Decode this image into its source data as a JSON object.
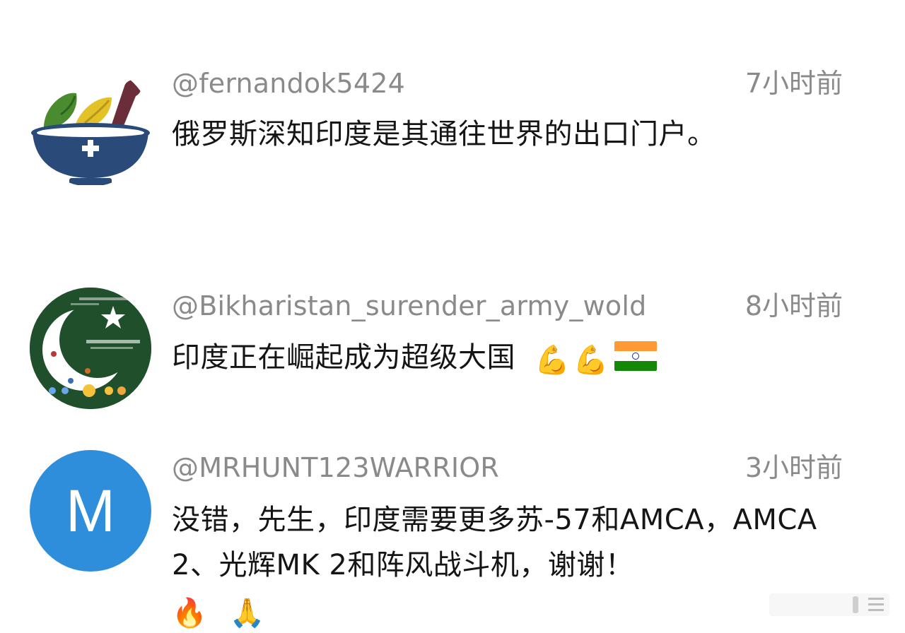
{
  "comments": [
    {
      "handle": "@fernandok5424",
      "time": "7小时前",
      "text": "俄罗斯深知印度是其通往世界的出口门户。",
      "avatar": {
        "type": "mortar-bowl-icon",
        "colors": {
          "bowl": "#2a4a79",
          "leaf1": "#4b8b2f",
          "leaf2": "#e3c228",
          "pestle": "#6b2d3a"
        }
      }
    },
    {
      "handle": "@Bikharistan_surender_army_wold",
      "time": "8小时前",
      "text": "印度正在崛起成为超级大国",
      "emoji": [
        "💪",
        "💪"
      ],
      "flag": "india-flag-icon",
      "avatar": {
        "type": "crescent-star-image",
        "colors": {
          "background": "#1f4f2b",
          "crescent": "#ffffff"
        }
      }
    },
    {
      "handle": "@MRHUNT123WARRIOR",
      "time": "3小时前",
      "text": "没错，先生，印度需要更多苏-57和AMCA，AMCA 2、光辉MK 2和阵风战斗机，谢谢！",
      "emoji": [
        "🔥",
        "🙏"
      ],
      "avatar": {
        "type": "letter",
        "letter": "M",
        "color": "#2f8edc"
      }
    }
  ],
  "colors": {
    "meta_text": "#8a8a8a",
    "body_text": "#151515",
    "flag_saffron": "#ff9933",
    "flag_white": "#ffffff",
    "flag_green": "#138808"
  }
}
